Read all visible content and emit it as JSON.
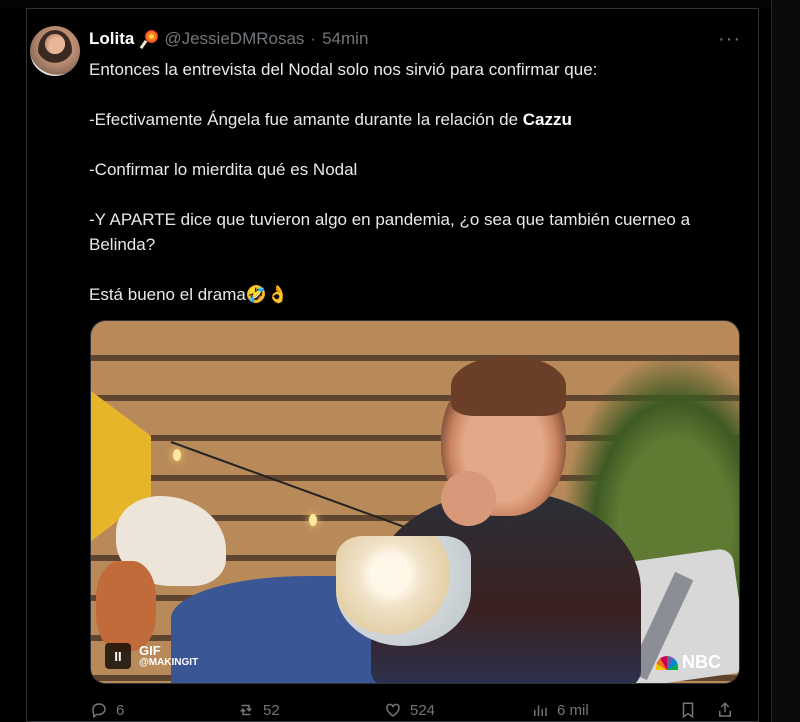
{
  "tweet": {
    "display_name": "Lolita",
    "handle": "@JessieDMRosas",
    "separator": "·",
    "time": "54min",
    "more_label": "···",
    "paragraphs": {
      "p1": "Entonces la entrevista del Nodal solo nos sirvió para confirmar que:",
      "p2_pre": "-Efectivamente Ángela fue amante durante la relación de ",
      "p2_bold": "Cazzu",
      "p3": "-Confirmar lo mierdita qué es Nodal",
      "p4": "-Y APARTE dice que tuvieron algo en pandemia, ¿o sea que también cuerneo a Belinda?",
      "p5": "Está bueno el drama🤣👌"
    },
    "media": {
      "type": "GIF",
      "gif_label": "GIF",
      "gif_source": "@MAKINGIT",
      "pause_glyph": "II",
      "network_label": "NBC"
    },
    "actions": {
      "replies": "6",
      "reposts": "52",
      "likes": "524",
      "views": "6 mil"
    }
  },
  "icons": {
    "avatar": "user-avatar",
    "name_emoji": "lollipop-icon",
    "more": "more-horizontal-icon",
    "reply": "reply-icon",
    "repost": "repost-icon",
    "like": "heart-icon",
    "views": "views-icon",
    "bookmark": "bookmark-icon",
    "share": "share-icon"
  },
  "colors": {
    "background": "#000000",
    "text": "#e7e9ea",
    "muted": "#71767b",
    "border": "#2f3336"
  }
}
